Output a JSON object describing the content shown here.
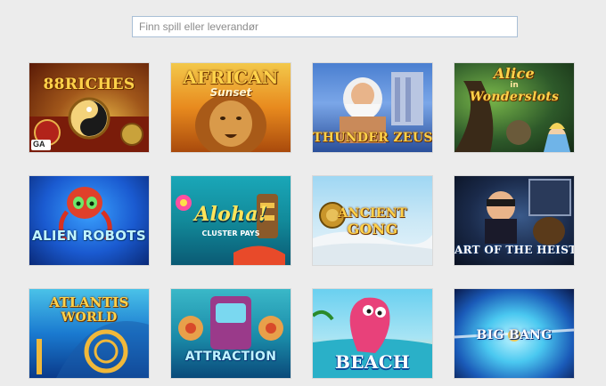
{
  "search": {
    "placeholder": "Finn spill eller leverandør",
    "value": ""
  },
  "games": [
    {
      "title": "RICHES",
      "badge_prefix": "88",
      "provider_logo": "GA"
    },
    {
      "title": "AFRICAN",
      "subtitle": "Sunset"
    },
    {
      "title": "THUNDER ZEUS"
    },
    {
      "title": "Alice",
      "title_connector": "in",
      "title_second": "Wonderslots"
    },
    {
      "title": "ALIEN ROBOTS"
    },
    {
      "title": "Aloha!",
      "subtitle": "CLUSTER PAYS"
    },
    {
      "title": "ANCIENT",
      "subtitle": "GONG"
    },
    {
      "title": "ART OF THE HEIST"
    },
    {
      "title": "ATLANTIS",
      "subtitle": "WORLD"
    },
    {
      "title": "ATTRACTION"
    },
    {
      "title": "BEACH"
    },
    {
      "title": "BIG BANG"
    }
  ],
  "colors": {
    "page_background": "#ececec",
    "search_border": "#a9bfd6"
  }
}
